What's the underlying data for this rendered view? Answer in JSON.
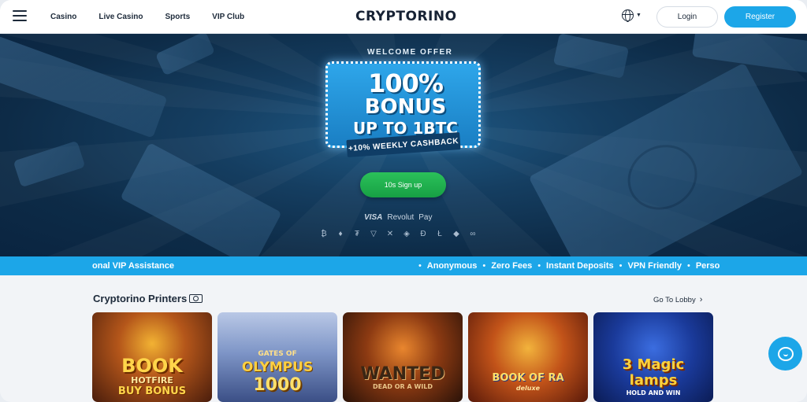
{
  "header": {
    "menu_icon": "hamburger-icon",
    "nav": [
      "Casino",
      "Live Casino",
      "Sports",
      "VIP Club"
    ],
    "logo": "CRYPTORINO",
    "language_icon": "globe-icon",
    "login_label": "Login",
    "register_label": "Register"
  },
  "hero": {
    "welcome_label": "WELCOME OFFER",
    "promo_line1": "100%",
    "promo_line2": "BONUS",
    "promo_line3": "UP TO 1BTC",
    "cashback": "+10% WEEKLY CASHBACK",
    "signup_label": "10s Sign up",
    "payments": [
      "VISA",
      "Revolut",
      " Pay"
    ],
    "crypto_icons": [
      "₿",
      "♦",
      "₮",
      "▽",
      "✕",
      "◈",
      "Đ",
      "Ł",
      "◆",
      "∞"
    ]
  },
  "ticker": {
    "items": [
      "onal VIP Assistance",
      "Anonymous",
      "Zero Fees",
      "Instant Deposits",
      "VPN Friendly",
      "Perso"
    ]
  },
  "section": {
    "title": "Cryptorino Printers",
    "title_icon": "cash-icon",
    "lobby_label": "Go To Lobby"
  },
  "games": [
    {
      "name": "BOOK HOTFIRE BUY BONUS",
      "line1": "BOOK",
      "line2": "HOTFIRE",
      "line3": "BUY BONUS"
    },
    {
      "name": "GATES OF OLYMPUS 1000",
      "line1": "GATES OF",
      "line2": "OLYMPUS",
      "line3": "1000"
    },
    {
      "name": "WANTED DEAD OR A WILD",
      "line1": "WANTED",
      "line2": "DEAD OR A WILD",
      "line3": ""
    },
    {
      "name": "BOOK OF RA DELUXE",
      "line1": "BOOK OF RA",
      "line2": "deluxe",
      "line3": ""
    },
    {
      "name": "3 MAGIC LAMPS HOLD AND WIN",
      "line1": "3 Magic",
      "line2": "lamps",
      "line3": "HOLD AND WIN"
    }
  ],
  "chat_icon": "chat-bubble-icon"
}
